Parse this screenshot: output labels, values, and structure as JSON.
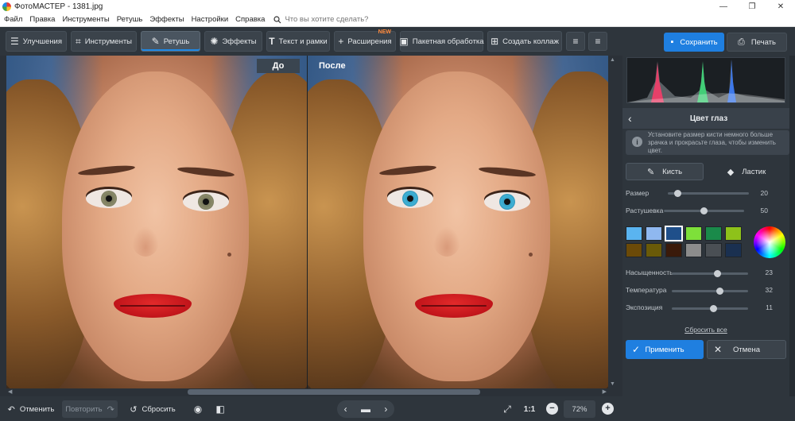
{
  "window": {
    "title": "ФотоМАСТЕР - 1381.jpg",
    "controls": [
      "—",
      "❐",
      "✕"
    ]
  },
  "menu": {
    "items": [
      "Файл",
      "Правка",
      "Инструменты",
      "Ретушь",
      "Эффекты",
      "Настройки",
      "Справка"
    ],
    "search_placeholder": "Что вы хотите сделать?"
  },
  "toolbar": {
    "tabs": [
      {
        "label": "Улучшения",
        "icon": "sliders-icon"
      },
      {
        "label": "Инструменты",
        "icon": "crop-icon"
      },
      {
        "label": "Ретушь",
        "icon": "brush-icon"
      },
      {
        "label": "Эффекты",
        "icon": "sparkle-icon"
      },
      {
        "label": "Текст и рамки",
        "icon": "text-icon"
      },
      {
        "label": "Расширения",
        "icon": "plus-icon",
        "badge": "NEW"
      },
      {
        "label": "Пакетная обработка",
        "icon": "image-icon"
      },
      {
        "label": "Создать коллаж",
        "icon": "collage-icon"
      }
    ],
    "active_tab": "Ретушь",
    "save_label": "Сохранить",
    "print_label": "Печать"
  },
  "canvas": {
    "before_label": "До",
    "after_label": "После"
  },
  "bottom": {
    "undo_label": "Отменить",
    "redo_label": "Повторить",
    "reset_label": "Сбросить",
    "zoom_ratio": "1:1",
    "zoom_value": "72%"
  },
  "panel": {
    "title": "Цвет глаз",
    "hint": "Установите размер кисти немного больше зрачка и прокрасьте глаза, чтобы изменить цвет.",
    "brush_label": "Кисть",
    "eraser_label": "Ластик",
    "size": {
      "label": "Размер",
      "value": "20",
      "fraction": 0.12
    },
    "feather": {
      "label": "Растушевка",
      "value": "50",
      "fraction": 0.5
    },
    "swatches": [
      "#5ab4f0",
      "#8fb8f0",
      "#1f4f8a",
      "#7ee03a",
      "#1a8a4a",
      "#8ec21a",
      "#6b4a08",
      "#6a5a08",
      "#3a1a0a",
      "#8c8c8c",
      "#4a4f54",
      "#1a3050"
    ],
    "selected_swatch": 2,
    "saturation": {
      "label": "Насыщенность",
      "value": "23",
      "fraction": 0.6
    },
    "temperature": {
      "label": "Температура",
      "value": "32",
      "fraction": 0.63
    },
    "exposure": {
      "label": "Экспозиция",
      "value": "11",
      "fraction": 0.55
    },
    "reset_all": "Сбросить все",
    "apply_label": "Применить",
    "cancel_label": "Отмена"
  },
  "colors": {
    "accent": "#1f7fe0",
    "panel_bg": "#2e353c"
  }
}
